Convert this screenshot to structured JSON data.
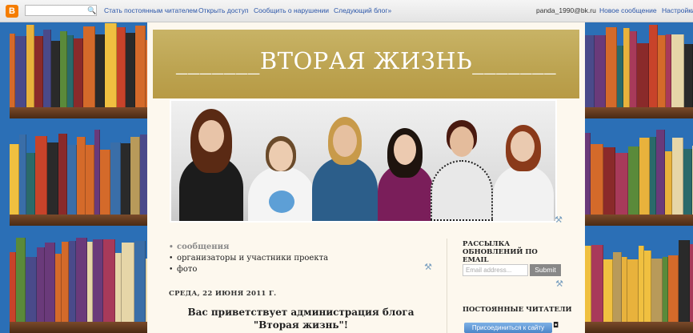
{
  "navbar": {
    "logo": "B",
    "search_icon": "magnifier-icon",
    "links": [
      "Стать постоянным читателем",
      "Открыть доступ",
      "Сообщить о нарушении",
      "Следующий блог»"
    ],
    "user": "panda_1990@bk.ru",
    "new_post": "Новое сообщение",
    "settings": "Настройки"
  },
  "header": {
    "title": "_______ВТОРАЯ ЖИЗНЬ_______"
  },
  "page_nav": {
    "items": [
      "сообщения",
      "организаторы и участники проекта",
      "фото"
    ]
  },
  "post": {
    "date": "СРЕДА, 22 ИЮНЯ 2011 Г.",
    "title_line1": "Вас приветствует администрация блога",
    "title_line2": "\"Вторая жизнь\"!"
  },
  "sidebar": {
    "email_title": "РАССЫЛКА ОБНОВЛЕНИЙ ПО EMAIL",
    "email_placeholder": "Email address...",
    "submit": "Submit",
    "followers_title": "ПОСТОЯННЫЕ ЧИТАТЕЛИ",
    "join": "Присоединиться к сайту"
  },
  "colors": {
    "header_gold": "#bca350",
    "frame_blue": "#2b6fb6",
    "content_bg": "#fdf8ee"
  }
}
